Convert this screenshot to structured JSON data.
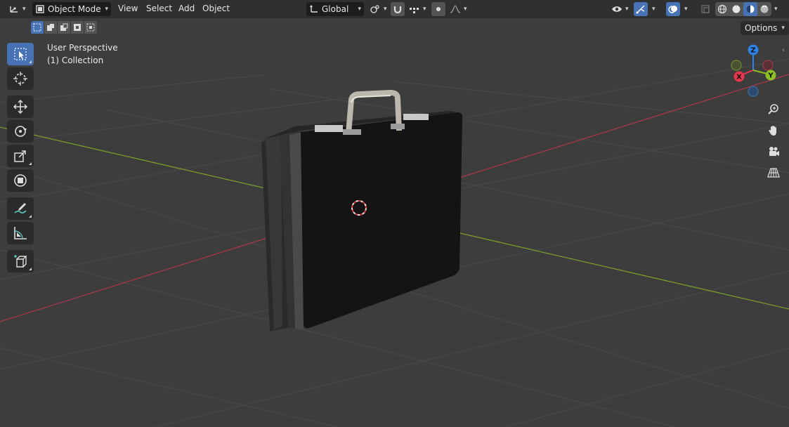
{
  "header": {
    "editor_type_icon": "3d-viewport-icon",
    "mode": {
      "label": "Object Mode"
    },
    "menus": [
      "View",
      "Select",
      "Add",
      "Object"
    ],
    "transform_orientation": {
      "label": "Global"
    },
    "options_label": "Options"
  },
  "viewport": {
    "view_name": "User Perspective",
    "collection_info": "(1) Collection"
  },
  "gizmo": {
    "x": "X",
    "y": "Y",
    "z": "Z"
  },
  "colors": {
    "header_bg": "#303030",
    "viewport_bg": "#3d3d3d",
    "accent": "#4772b3",
    "x_axis": "#e8364e",
    "y_axis": "#8cbf26",
    "z_axis": "#2d82e6"
  }
}
